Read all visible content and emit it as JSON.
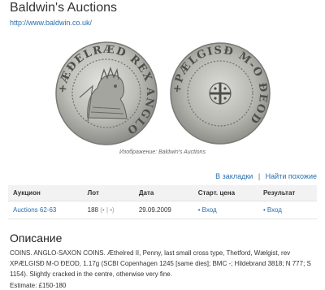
{
  "header": {
    "title": "Baldwin's Auctions",
    "link": "http://www.baldwin.co.uk/"
  },
  "image": {
    "caption": "Изображение: Baldwin's Auctions",
    "obverse_legend": "+ÆÐELRÆD REX ANGLO",
    "reverse_legend": "+PÆLGISÐ M-O ÐEOD"
  },
  "actions": {
    "bookmarks": "В закладки",
    "find_similar": "Найти похожие"
  },
  "table": {
    "headers": [
      "Аукцион",
      "Лот",
      "Дата",
      "Старт. цена",
      "Результат"
    ],
    "row": {
      "auction": "Auctions 62-63",
      "lot": "188",
      "lot_nav": "(• | •)",
      "date": "29.09.2009",
      "start_price": "Вход",
      "result": "Вход"
    }
  },
  "description": {
    "heading": "Описание",
    "text": "COINS. ANGLO-SAXON COINS. Æthelred II, Penny, last small cross type, Thetford, Wælgist, rev XPÆLGISÐ M-O ÐEOD, 1.17g (SCBI Copenhagen 1245 [same dies]; BMC -; Hildebrand 3818; N 777; S 1154). Slightly cracked in the centre, otherwise very fine.",
    "estimate": "Estimate: £150-180"
  },
  "colors": {
    "link": "#2a6fb0",
    "table_header_bg": "#f2f2f2",
    "coin_silver": "#b8b8b4"
  }
}
